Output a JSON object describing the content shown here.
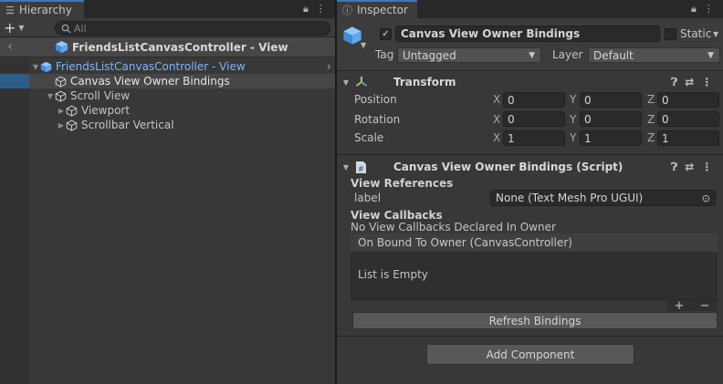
{
  "hierarchy": {
    "tab_title": "Hierarchy",
    "search_placeholder": "All",
    "add_label": "+",
    "breadcrumb_title": "FriendsListCanvasController - View",
    "tree": [
      {
        "label": "FriendsListCanvasController - View",
        "depth": 0,
        "expanded": true,
        "is_prefab": true
      },
      {
        "label": "Canvas View Owner Bindings",
        "depth": 1,
        "expanded": null,
        "selected": true
      },
      {
        "label": "Scroll View",
        "depth": 1,
        "expanded": true
      },
      {
        "label": "Viewport",
        "depth": 2,
        "expanded": false
      },
      {
        "label": "Scrollbar Vertical",
        "depth": 2,
        "expanded": false
      }
    ]
  },
  "inspector": {
    "tab_title": "Inspector",
    "object_name": "Canvas View Owner Bindings",
    "static_label": "Static",
    "tag_label": "Tag",
    "tag_value": "Untagged",
    "layer_label": "Layer",
    "layer_value": "Default",
    "transform": {
      "title": "Transform",
      "rows": [
        {
          "label": "Position",
          "x": "0",
          "y": "0",
          "z": "0"
        },
        {
          "label": "Rotation",
          "x": "0",
          "y": "0",
          "z": "0"
        },
        {
          "label": "Scale",
          "x": "1",
          "y": "1",
          "z": "1"
        }
      ],
      "axis_x": "X",
      "axis_y": "Y",
      "axis_z": "Z"
    },
    "script": {
      "title": "Canvas View Owner Bindings (Script)",
      "view_references_header": "View References",
      "label_field": "label",
      "label_value": "None (Text Mesh Pro UGUI)",
      "view_callbacks_header": "View Callbacks",
      "no_callbacks_text": "No View Callbacks Declared In Owner",
      "event_title": "On Bound To Owner (CanvasController)",
      "list_empty": "List is Empty",
      "plus": "+",
      "minus": "−",
      "refresh_button": "Refresh Bindings"
    },
    "add_component_button": "Add Component"
  },
  "colors": {
    "accent": "#3a79bb",
    "selection": "#2c5d87",
    "prefab_text": "#7bb8f5",
    "panel": "#383838"
  }
}
